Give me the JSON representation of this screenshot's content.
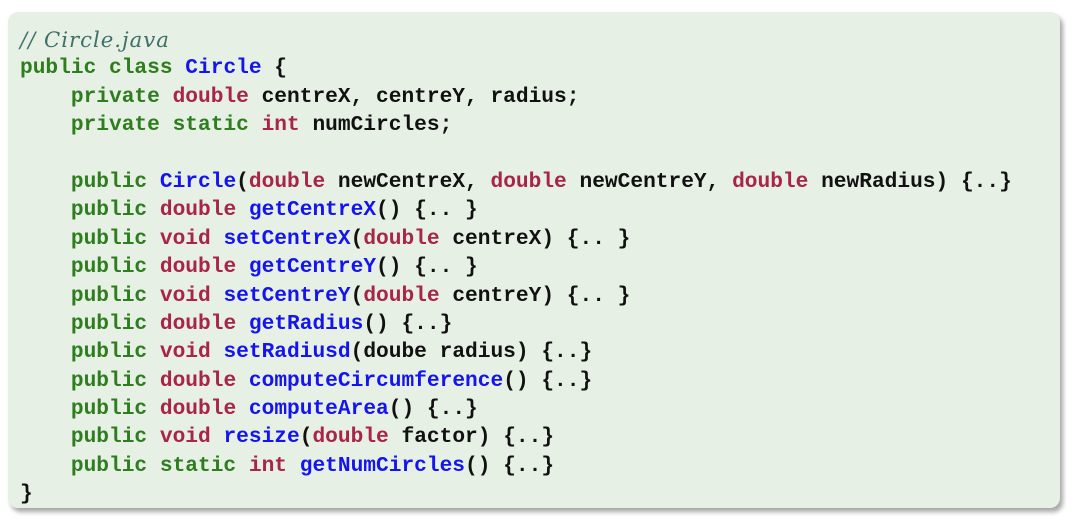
{
  "listing": {
    "lines": [
      [
        [
          "c",
          "// Circle.java"
        ]
      ],
      [
        [
          "k",
          "public class "
        ],
        [
          "f",
          "Circle"
        ],
        [
          "p",
          " {"
        ]
      ],
      [
        [
          "p",
          "    "
        ],
        [
          "k",
          "private "
        ],
        [
          "t",
          "double"
        ],
        [
          "p",
          " centreX, centreY, radius;"
        ]
      ],
      [
        [
          "p",
          "    "
        ],
        [
          "k",
          "private static "
        ],
        [
          "t",
          "int"
        ],
        [
          "p",
          " numCircles;"
        ]
      ],
      [],
      [
        [
          "p",
          "    "
        ],
        [
          "k",
          "public "
        ],
        [
          "f",
          "Circle"
        ],
        [
          "p",
          "("
        ],
        [
          "t",
          "double"
        ],
        [
          "p",
          " newCentreX, "
        ],
        [
          "t",
          "double"
        ],
        [
          "p",
          " newCentreY, "
        ],
        [
          "t",
          "double"
        ],
        [
          "p",
          " newRadius) {..}"
        ]
      ],
      [
        [
          "p",
          "    "
        ],
        [
          "k",
          "public "
        ],
        [
          "t",
          "double "
        ],
        [
          "f",
          "getCentreX"
        ],
        [
          "p",
          "() {.. }"
        ]
      ],
      [
        [
          "p",
          "    "
        ],
        [
          "k",
          "public "
        ],
        [
          "t",
          "void "
        ],
        [
          "f",
          "setCentreX"
        ],
        [
          "p",
          "("
        ],
        [
          "t",
          "double"
        ],
        [
          "p",
          " centreX) {.. }"
        ]
      ],
      [
        [
          "p",
          "    "
        ],
        [
          "k",
          "public "
        ],
        [
          "t",
          "double "
        ],
        [
          "f",
          "getCentreY"
        ],
        [
          "p",
          "() {.. }"
        ]
      ],
      [
        [
          "p",
          "    "
        ],
        [
          "k",
          "public "
        ],
        [
          "t",
          "void "
        ],
        [
          "f",
          "setCentreY"
        ],
        [
          "p",
          "("
        ],
        [
          "t",
          "double"
        ],
        [
          "p",
          " centreY) {.. }"
        ]
      ],
      [
        [
          "p",
          "    "
        ],
        [
          "k",
          "public "
        ],
        [
          "t",
          "double "
        ],
        [
          "f",
          "getRadius"
        ],
        [
          "p",
          "() {..}"
        ]
      ],
      [
        [
          "p",
          "    "
        ],
        [
          "k",
          "public "
        ],
        [
          "t",
          "void "
        ],
        [
          "f",
          "setRadiusd"
        ],
        [
          "p",
          "(doube radius) {..}"
        ]
      ],
      [
        [
          "p",
          "    "
        ],
        [
          "k",
          "public "
        ],
        [
          "t",
          "double "
        ],
        [
          "f",
          "computeCircumference"
        ],
        [
          "p",
          "() {..}"
        ]
      ],
      [
        [
          "p",
          "    "
        ],
        [
          "k",
          "public "
        ],
        [
          "t",
          "double "
        ],
        [
          "f",
          "computeArea"
        ],
        [
          "p",
          "() {..}"
        ]
      ],
      [
        [
          "p",
          "    "
        ],
        [
          "k",
          "public "
        ],
        [
          "t",
          "void "
        ],
        [
          "f",
          "resize"
        ],
        [
          "p",
          "("
        ],
        [
          "t",
          "double"
        ],
        [
          "p",
          " factor) {..}"
        ]
      ],
      [
        [
          "p",
          "    "
        ],
        [
          "k",
          "public static "
        ],
        [
          "t",
          "int "
        ],
        [
          "f",
          "getNumCircles"
        ],
        [
          "p",
          "() {..}"
        ]
      ],
      [
        [
          "p",
          "}"
        ]
      ]
    ]
  }
}
